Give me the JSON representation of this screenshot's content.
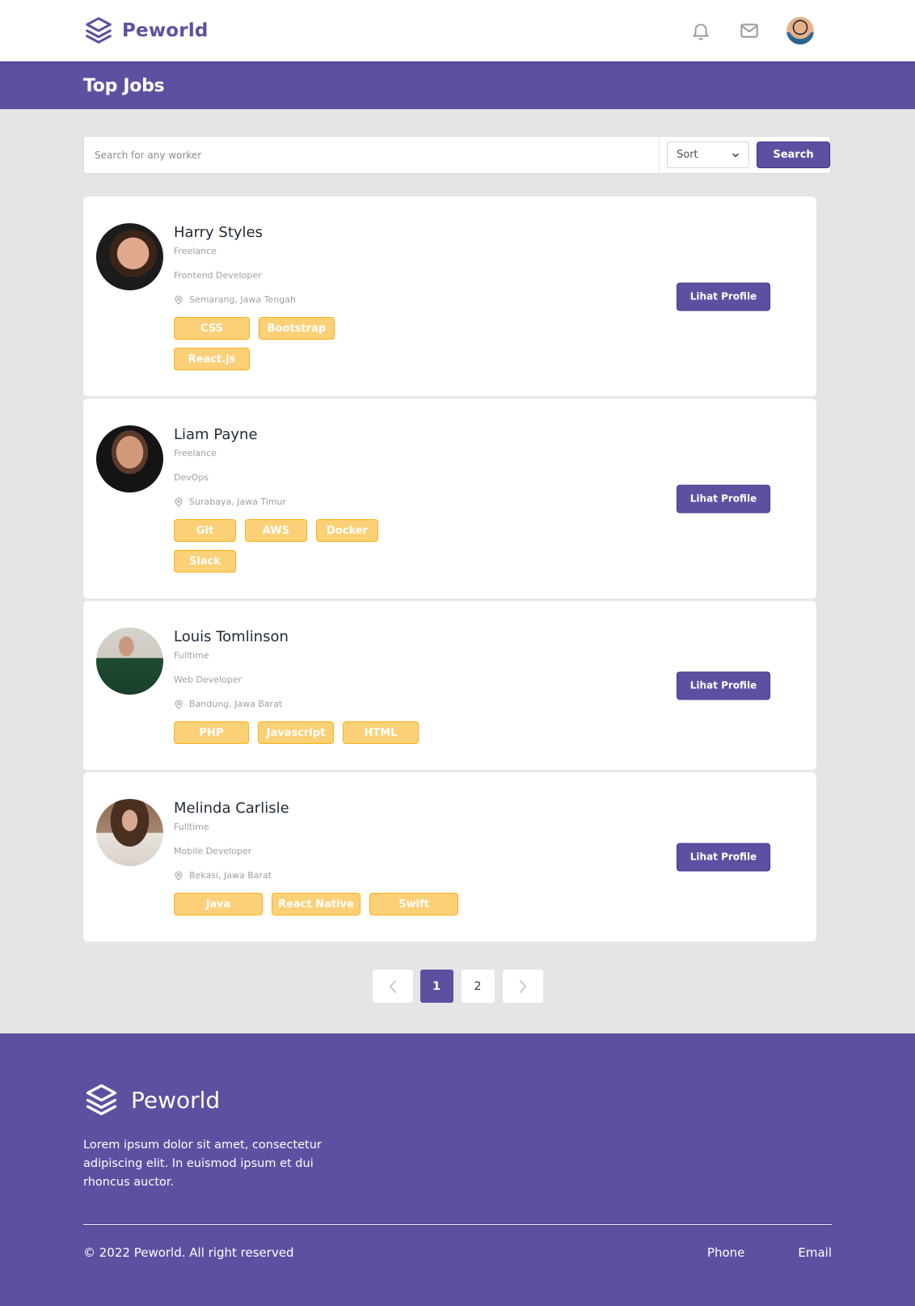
{
  "navbar": {
    "brand": "Peworld",
    "icons": [
      "layers-logo-icon",
      "bell-icon",
      "mail-icon",
      "user-avatar"
    ]
  },
  "title_bar": {
    "title": "Top Jobs"
  },
  "search": {
    "placeholder": "Search for any worker",
    "value": "",
    "sort_label": "Sort",
    "search_label": "Search"
  },
  "workers": [
    {
      "name": "Harry Styles",
      "type": "Freelance",
      "role": "Frontend Developer",
      "location": "Semarang, Jawa Tengah",
      "skills": [
        "CSS",
        "Bootstrap",
        "React.js"
      ],
      "button": "Lihat Profile"
    },
    {
      "name": "Liam Payne",
      "type": "Freelance",
      "role": "DevOps",
      "location": "Surabaya, Jawa Timur",
      "skills": [
        "Git",
        "AWS",
        "Docker",
        "Slack"
      ],
      "button": "Lihat Profile"
    },
    {
      "name": "Louis Tomlinson",
      "type": "Fulltime",
      "role": "Web Developer",
      "location": "Bandung, Jawa Barat",
      "skills": [
        "PHP",
        "Javascript",
        "HTML"
      ],
      "button": "Lihat Profile"
    },
    {
      "name": "Melinda Carlisle",
      "type": "Fulltime",
      "role": "Mobile Developer",
      "location": "Bekasi, Jawa Barat",
      "skills": [
        "Java",
        "React Native",
        "Swift"
      ],
      "button": "Lihat Profile"
    }
  ],
  "pagination": {
    "pages": [
      "1",
      "2"
    ],
    "current": "1"
  },
  "footer": {
    "brand": "Peworld",
    "description": "Lorem ipsum dolor sit amet, consectetur adipiscing elit. In euismod ipsum et dui rhoncus auctor.",
    "copyright": "© 2022 Peworld. All right reserved",
    "links": [
      "Phone",
      "Email"
    ]
  },
  "colors": {
    "primary": "#5e50a1",
    "skill_bg": "#fbd077",
    "skill_border": "#fbb017",
    "page_bg": "#e5e5e5"
  }
}
